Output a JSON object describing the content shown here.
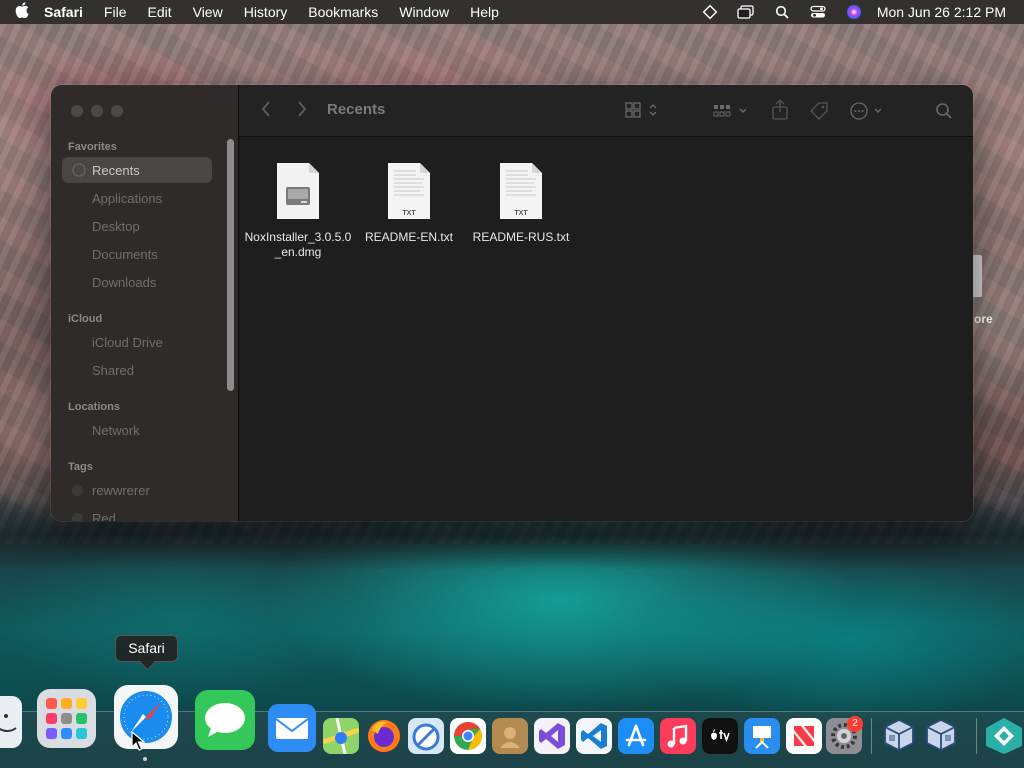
{
  "menubar": {
    "app_name": "Safari",
    "items": [
      "File",
      "Edit",
      "View",
      "History",
      "Bookmarks",
      "Window",
      "Help"
    ],
    "clock": "Mon Jun 26  2:12 PM"
  },
  "finder": {
    "title": "Recents",
    "sidebar": {
      "favorites_header": "Favorites",
      "favorites": [
        "Recents",
        "Applications",
        "Desktop",
        "Documents",
        "Downloads"
      ],
      "icloud_header": "iCloud",
      "icloud": [
        "iCloud Drive",
        "Shared"
      ],
      "locations_header": "Locations",
      "locations": [
        "Network"
      ],
      "tags_header": "Tags",
      "tags": [
        "rewwrerer",
        "Red"
      ]
    },
    "files": [
      {
        "name": "NoxInstaller_3.0.5.0_en.dmg",
        "kind": "dmg"
      },
      {
        "name": "README-EN.txt",
        "kind": "txt",
        "badge": "TXT"
      },
      {
        "name": "README-RUS.txt",
        "kind": "txt",
        "badge": "TXT"
      }
    ]
  },
  "desktop": {
    "partial_label": "ore"
  },
  "dock": {
    "tooltip": "Safari",
    "settings_badge": "2"
  }
}
